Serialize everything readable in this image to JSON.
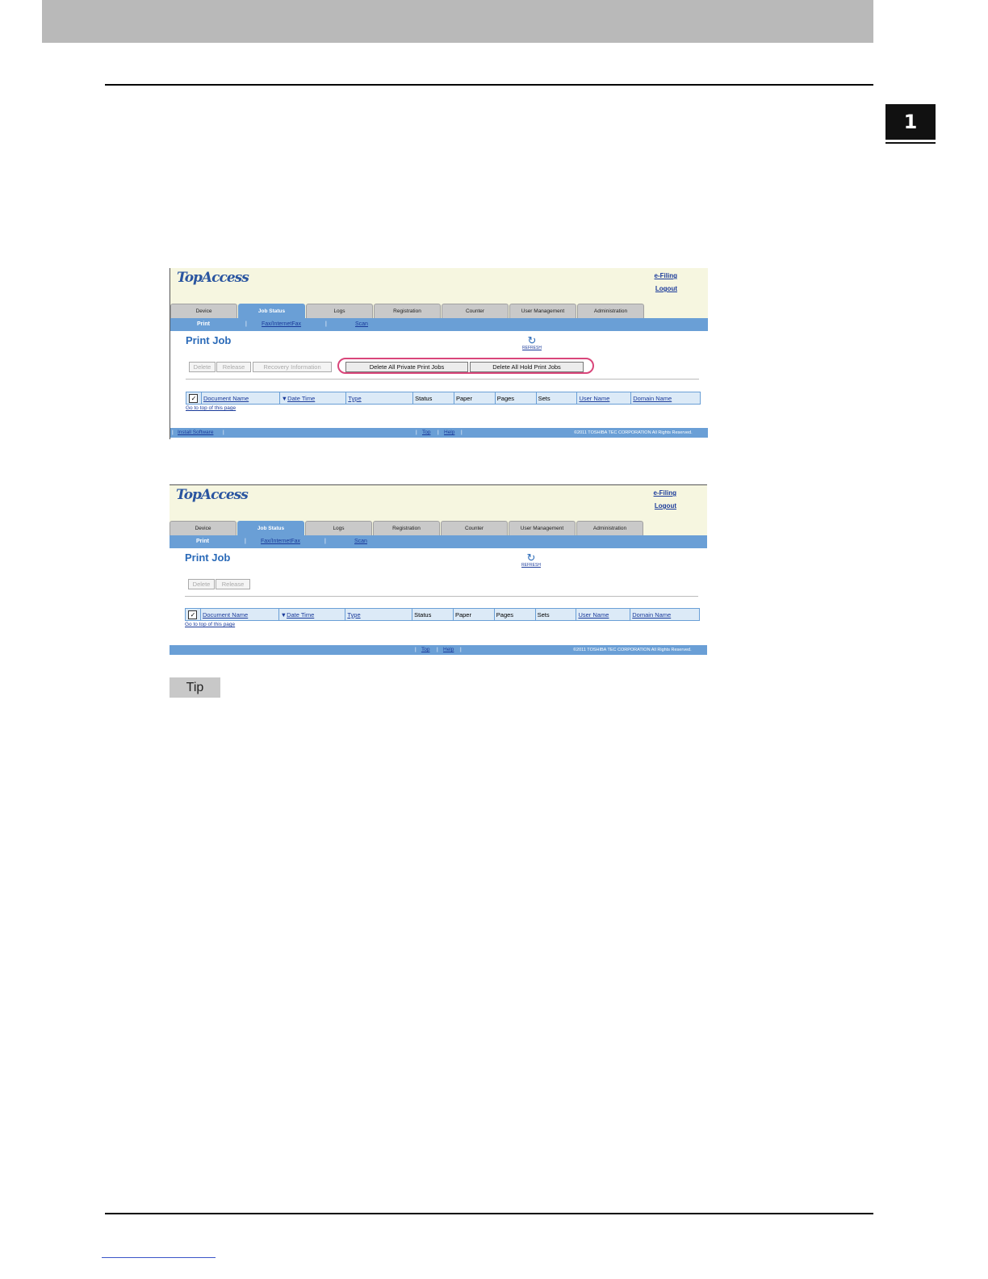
{
  "chapter": {
    "number": "1"
  },
  "screens": [
    {
      "logo": "TopAccess",
      "top_links": {
        "efiling": "e-Filing",
        "logout": "Logout"
      },
      "tabs": [
        "Device",
        "Job Status",
        "Logs",
        "Registration",
        "Counter",
        "User Management",
        "Administration"
      ],
      "active_tab": "Job Status",
      "subnav": {
        "print": "Print",
        "fax": "Fax/InternetFax",
        "scan": "Scan"
      },
      "title": "Print Job",
      "refresh": "REFRESH",
      "buttons": {
        "delete": "Delete",
        "release": "Release",
        "recovery": "Recovery Information",
        "delete_private": "Delete All Private Print Jobs",
        "delete_hold": "Delete All Hold Print Jobs"
      },
      "columns": [
        "Document Name",
        "Date Time",
        "Type",
        "Status",
        "Paper",
        "Pages",
        "Sets",
        "User Name",
        "Domain Name"
      ],
      "go_top": "Go to top of this page",
      "footer": {
        "install": "Install Software",
        "top": "Top",
        "help": "Help",
        "copyright": "©2011 TOSHIBA TEC CORPORATION All Rights Reserved."
      }
    },
    {
      "logo": "TopAccess",
      "top_links": {
        "efiling": "e-Filing",
        "logout": "Logout"
      },
      "tabs": [
        "Device",
        "Job Status",
        "Logs",
        "Registration",
        "Counter",
        "User Management",
        "Administration"
      ],
      "active_tab": "Job Status",
      "subnav": {
        "print": "Print",
        "fax": "Fax/InternetFax",
        "scan": "Scan"
      },
      "title": "Print Job",
      "refresh": "REFRESH",
      "buttons": {
        "delete": "Delete",
        "release": "Release"
      },
      "columns": [
        "Document Name",
        "Date Time",
        "Type",
        "Status",
        "Paper",
        "Pages",
        "Sets",
        "User Name",
        "Domain Name"
      ],
      "go_top": "Go to top of this page",
      "footer": {
        "top": "Top",
        "help": "Help",
        "copyright": "©2011 TOSHIBA TEC CORPORATION All Rights Reserved."
      }
    }
  ],
  "tip": "Tip",
  "colors": {
    "highlight": "#d9467a",
    "nav_blue": "#6a9fd6",
    "header_cream": "#f6f6e0"
  }
}
